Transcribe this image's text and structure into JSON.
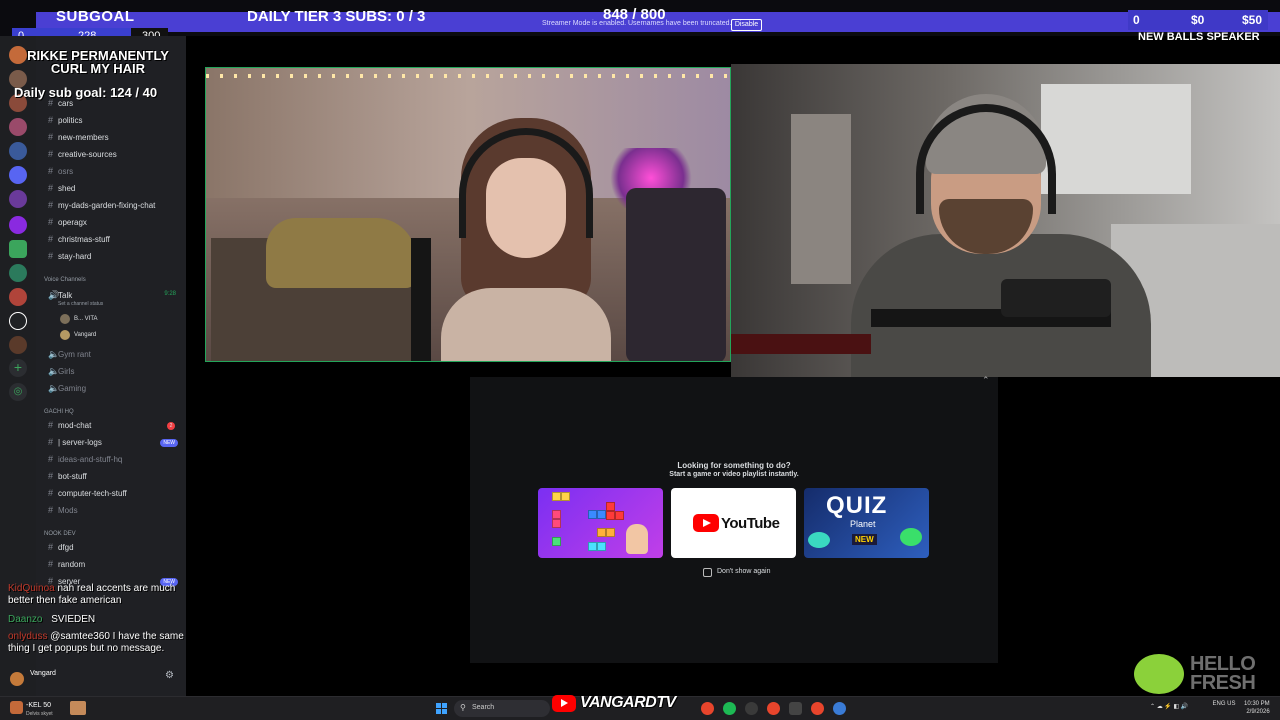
{
  "overlay": {
    "subgoal_label": "SUBGOAL",
    "daily_tier3": "DAILY TIER 3 SUBS: 0 / 3",
    "bits_progress": "848 / 800",
    "streamer_mode_notice": "Streamer Mode is enabled. Usernames have been truncated.",
    "disable_button": "Disable",
    "donation_markers": [
      "0",
      "$0",
      "$50"
    ],
    "goal_bar": {
      "min": "0",
      "current": "228",
      "max": "300",
      "fill_fraction": 0.76
    },
    "donation_next": "NEW BALLS SPEAKER",
    "goal_text": "RIKKE PERMANENTLY CURL MY HAIR",
    "daily_sub_goal": "Daily sub goal: 124 / 40"
  },
  "discord": {
    "channels_top": [
      {
        "name": "cars",
        "muted": false
      },
      {
        "name": "politics",
        "muted": false
      },
      {
        "name": "new-members",
        "muted": false
      },
      {
        "name": "creative-sources",
        "muted": false
      },
      {
        "name": "osrs",
        "muted": true
      },
      {
        "name": "shed",
        "muted": false
      },
      {
        "name": "my-dads-garden-fixing-chat",
        "muted": false
      },
      {
        "name": "operagx",
        "muted": false
      },
      {
        "name": "christmas-stuff",
        "muted": false
      },
      {
        "name": "stay-hard",
        "muted": false
      }
    ],
    "voice_category": "Voice Channels",
    "voice_channel": "Talk",
    "voice_channel_time": "9:28",
    "voice_status": "Set a channel status",
    "voice_users": [
      "B... VITA",
      "Vangard"
    ],
    "voice_others": [
      "Gym rant",
      "Girls",
      "Gaming"
    ],
    "category_gachi": "GACHI HQ",
    "gachi_channels": [
      {
        "name": "mod-chat",
        "muted": false
      },
      {
        "name": "| server-logs",
        "muted": false
      },
      {
        "name": "ideas-and-stuff-hq",
        "muted": true
      },
      {
        "name": "bot-stuff",
        "muted": false
      },
      {
        "name": "computer-tech-stuff",
        "muted": false
      },
      {
        "name": "Mods",
        "muted": true
      }
    ],
    "mod_chat_badge": "2",
    "new_badge": "NEW",
    "category_nook": "NOOK DEV",
    "nook_channels": [
      {
        "name": "dfgd",
        "muted": false
      },
      {
        "name": "random",
        "muted": false
      },
      {
        "name": "server",
        "muted": false
      }
    ],
    "current_user": "Vangard"
  },
  "chat": {
    "messages": [
      {
        "user": "KidQuinoa",
        "text": "nah real accents are much better then fake american"
      },
      {
        "user": "Daanzo",
        "text": "SVIEDEN"
      },
      {
        "user": "onlyduss",
        "text": "@samtee360 I have the same thing I get popups but no message."
      }
    ]
  },
  "activity": {
    "hint_title": "Looking for something to do?",
    "hint_sub": "Start a game or video playlist instantly.",
    "tiles": [
      "YouTube",
      "QUIZ",
      "Planet",
      "NEW"
    ],
    "dont_show_again": "Don't show again"
  },
  "sponsor": {
    "text": "HELLO FRESH"
  },
  "taskbar": {
    "weather_temp": "-KEL 50",
    "weather_desc": "Delvis skyet",
    "search_placeholder": "Search",
    "channel_banner": "VANGARDTV",
    "locale": "ENG US",
    "time": "10:30 PM",
    "date": "2/9/2026"
  },
  "colors": {
    "overlay_purple": "#4a3fd3",
    "discord_bg": "#1f2024",
    "online_green": "#23a55a",
    "youtube_red": "#ff0000",
    "hellofresh_lime": "#8bd13a"
  }
}
